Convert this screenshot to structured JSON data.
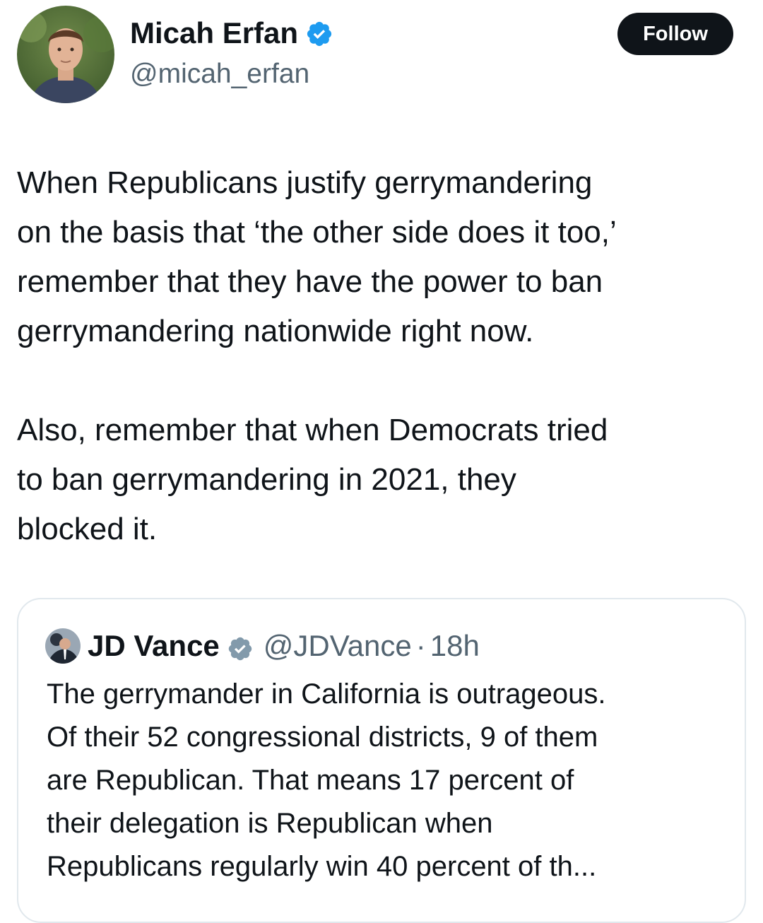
{
  "tweet": {
    "author": {
      "name": "Micah Erfan",
      "handle": "@micah_erfan",
      "verified_color": "#1d9bf0"
    },
    "follow_label": "Follow",
    "paragraphs": [
      "When Republicans justify gerrymandering\non the basis that ‘the other side does it too,’\nremember that they have the power to ban\ngerrymandering nationwide right now.",
      "Also, remember that when Democrats tried\nto ban gerrymandering in 2021, they\nblocked it."
    ]
  },
  "quote": {
    "author": {
      "name": "JD Vance",
      "handle": "@JDVance",
      "verified_color": "#829aab"
    },
    "separator": "·",
    "time": "18h",
    "text": "The gerrymander in California is outrageous.\nOf their 52 congressional districts, 9 of them\nare Republican. That means 17 percent of\ntheir delegation is Republican when\nRepublicans regularly win 40 percent of th..."
  },
  "icons": {
    "verified": "verified-badge-icon",
    "avatar": "avatar-photo"
  }
}
